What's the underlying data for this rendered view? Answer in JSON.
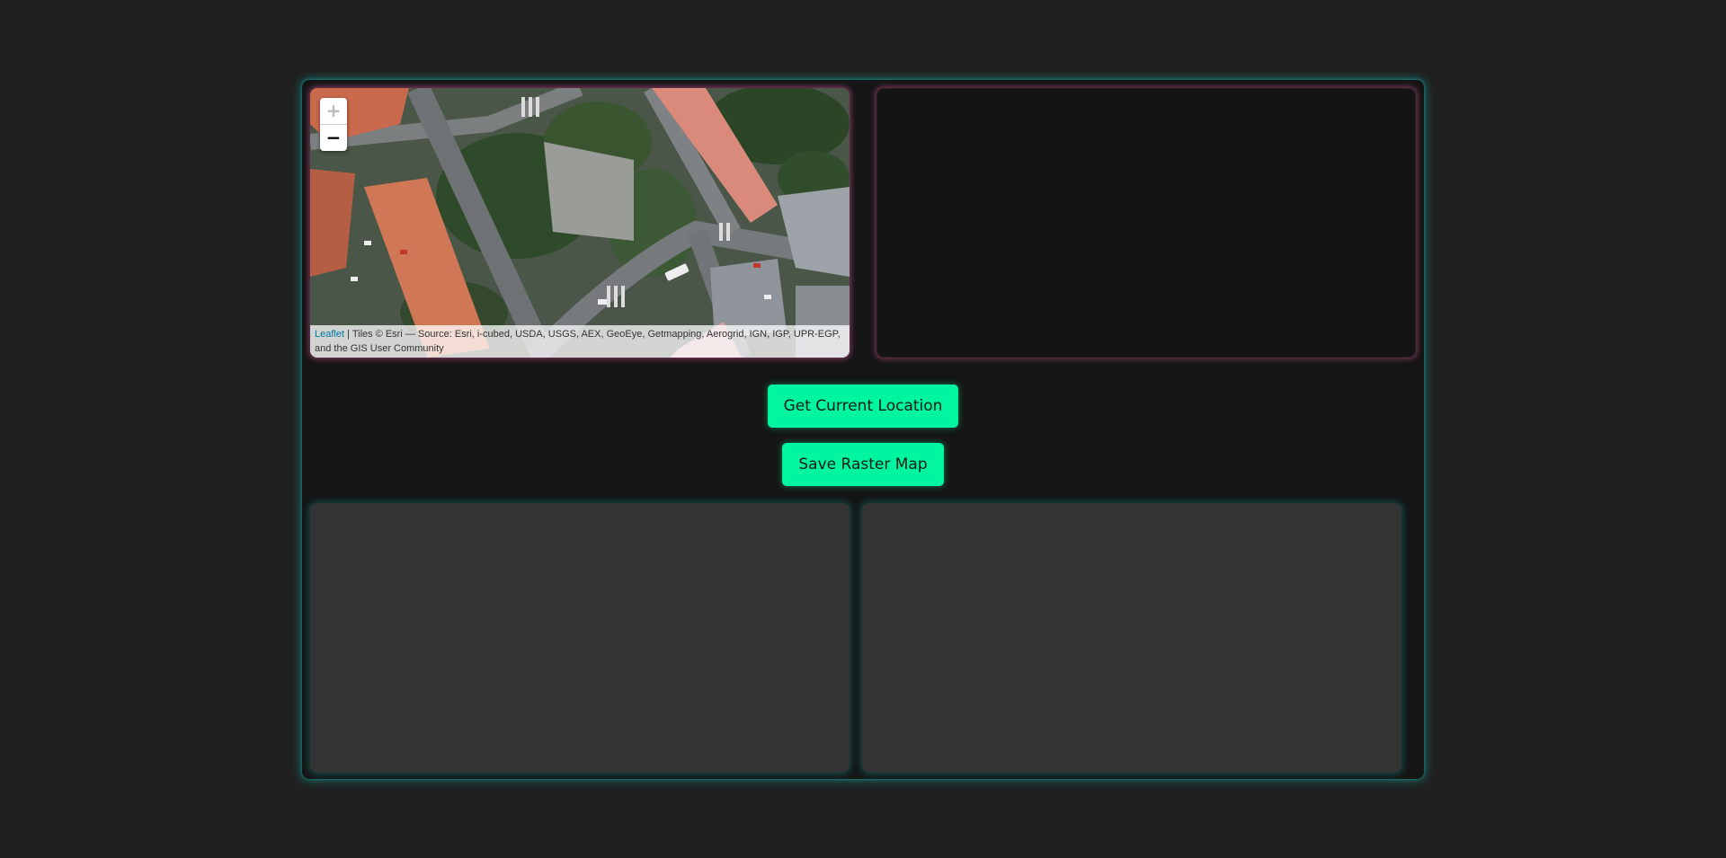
{
  "map": {
    "zoom_in": "+",
    "zoom_out": "−",
    "attribution_link": "Leaflet",
    "attribution_sep": " | ",
    "attribution_text": "Tiles © Esri — Source: Esri, i-cubed, USDA, USGS, AEX, GeoEye, Getmapping, Aerogrid, IGN, IGP, UPR-EGP, and the GIS User Community"
  },
  "controls": {
    "get_location_label": "Get Current Location",
    "save_raster_label": "Save Raster Map"
  },
  "colors": {
    "accent": "#00f5a0",
    "background": "#202020",
    "panel": "#151515",
    "glow_teal": "#14a096",
    "glow_pink": "#c8508c"
  }
}
